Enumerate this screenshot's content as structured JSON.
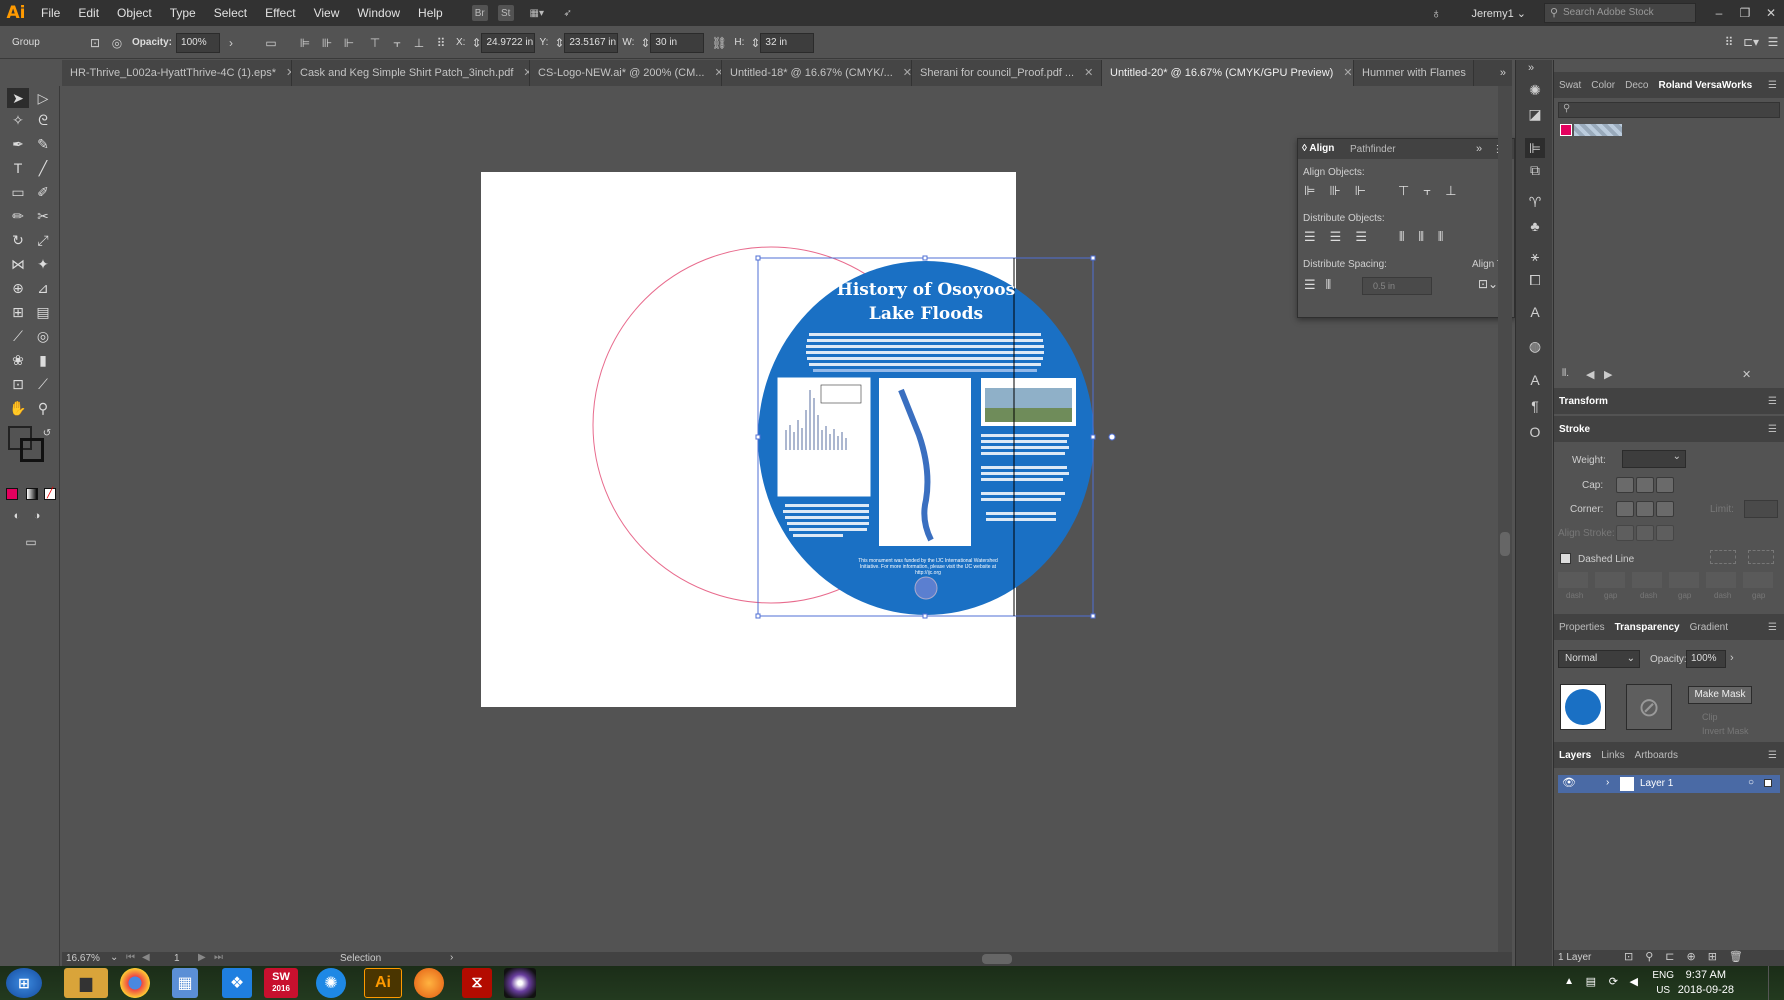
{
  "app": {
    "logo": "Ai"
  },
  "menu": [
    "File",
    "Edit",
    "Object",
    "Type",
    "Select",
    "Effect",
    "View",
    "Window",
    "Help"
  ],
  "menubar_icons": {
    "bridge": "Br",
    "stock": "St"
  },
  "user": "Jeremy1",
  "search": {
    "placeholder": "Search Adobe Stock"
  },
  "control": {
    "selection_type": "Group",
    "opacity_label": "Opacity:",
    "opacity_value": "100%",
    "x_label": "X:",
    "x_value": "24.9722 in",
    "y_label": "Y:",
    "y_value": "23.5167 in",
    "w_label": "W:",
    "w_value": "30 in",
    "h_label": "H:",
    "h_value": "32 in"
  },
  "tabs": [
    {
      "label": "HR-Thrive_L002a-HyattThrive-4C (1).eps*",
      "active": false
    },
    {
      "label": "Cask and Keg Simple Shirt Patch_3inch.pdf",
      "active": false
    },
    {
      "label": "CS-Logo-NEW.ai* @ 200% (CM...",
      "active": false
    },
    {
      "label": "Untitled-18* @ 16.67% (CMYK/...",
      "active": false
    },
    {
      "label": "Sherani for council_Proof.pdf ...",
      "active": false
    },
    {
      "label": "Untitled-20* @ 16.67% (CMYK/GPU Preview)",
      "active": true
    },
    {
      "label": "Hummer with Flames",
      "active": false
    }
  ],
  "placard": {
    "title_line1": "History of Osoyoos",
    "title_line2": "Lake Floods",
    "footer": "This monument was funded by the IJC International Watershed Initiative. For more information, please visit the IJC website at http://ijc.org"
  },
  "align_panel": {
    "tabs": [
      "Align",
      "Pathfinder"
    ],
    "align_objects": "Align Objects:",
    "distribute_objects": "Distribute Objects:",
    "distribute_spacing": "Distribute Spacing:",
    "align_to": "Align To:",
    "spacing_value": "0.5 in"
  },
  "right_panel": {
    "top_tabs": [
      "Swat",
      "Color",
      "Deco",
      "Roland VersaWorks"
    ],
    "transform": "Transform",
    "stroke": "Stroke",
    "weight": "Weight:",
    "cap": "Cap:",
    "corner": "Corner:",
    "limit": "Limit:",
    "align_stroke": "Align Stroke:",
    "dashed_line": "Dashed Line",
    "dash_labels": [
      "dash",
      "gap",
      "dash",
      "gap",
      "dash",
      "gap"
    ],
    "mid_tabs": [
      "Properties",
      "Transparency",
      "Gradient"
    ],
    "blend_mode": "Normal",
    "opacity_label": "Opacity:",
    "opacity_value": "100%",
    "make_mask": "Make Mask",
    "clip": "Clip",
    "invert_mask": "Invert Mask",
    "layer_tabs": [
      "Layers",
      "Links",
      "Artboards"
    ],
    "layer_name": "Layer 1",
    "layer_count": "1 Layer"
  },
  "status": {
    "zoom": "16.67%",
    "artboard": "1",
    "tool": "Selection"
  },
  "taskbar": {
    "lang_line1": "ENG",
    "lang_line2": "US",
    "time": "9:37 AM",
    "date": "2018-09-28",
    "sw_year": "2016"
  },
  "colors": {
    "placard_blue": "#1a70c4",
    "selection": "#4f6fd4",
    "circle_stroke": "#e86b8d",
    "ui_bg": "#535353"
  }
}
